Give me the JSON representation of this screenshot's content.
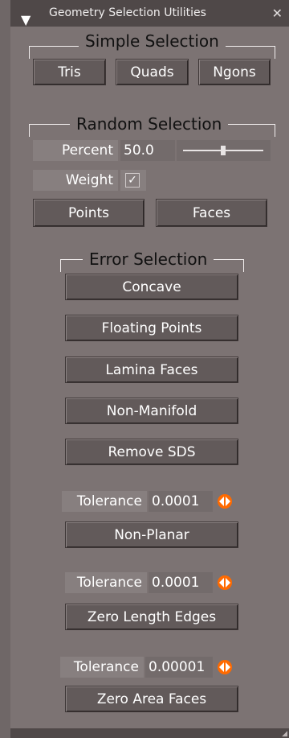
{
  "window": {
    "title": "Geometry Selection Utilities",
    "close_glyph": "✕",
    "menu_glyph": "▼"
  },
  "simple": {
    "title": "Simple Selection",
    "buttons": [
      "Tris",
      "Quads",
      "Ngons"
    ]
  },
  "random": {
    "title": "Random Selection",
    "percent_label": "Percent",
    "percent_value": "50.0",
    "percent_slider_fraction": 0.5,
    "weight_label": "Weight",
    "weight_checked": true,
    "check_glyph": "✓",
    "buttons": [
      "Points",
      "Faces"
    ]
  },
  "error": {
    "title": "Error Selection",
    "buttons": [
      "Concave",
      "Floating Points",
      "Lamina Faces",
      "Non-Manifold",
      "Remove SDS"
    ],
    "nonplanar": {
      "tol_label": "Tolerance",
      "tol_value": "0.0001",
      "button": "Non-Planar"
    },
    "zerolen": {
      "tol_label": "Tolerance",
      "tol_value": "0.0001",
      "button": "Zero Length Edges"
    },
    "zeroarea": {
      "tol_label": "Tolerance",
      "tol_value": "0.00001",
      "button": "Zero Area Faces"
    }
  },
  "colors": {
    "panel": "#7c7373",
    "titlebar": "#4f4848",
    "button": "#625a5a",
    "spinner": "#ff6a00"
  }
}
